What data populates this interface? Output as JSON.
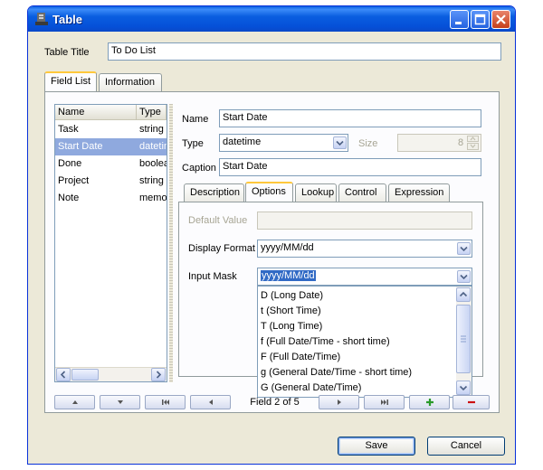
{
  "window": {
    "title": "Table",
    "colors": {
      "titlebar": "#0a5ee0",
      "close": "#c5401c",
      "selection": "#316ac5"
    }
  },
  "table_title": {
    "label": "Table Title",
    "value": "To Do List"
  },
  "main_tabs": [
    {
      "label": "Field List"
    },
    {
      "label": "Information"
    }
  ],
  "field_grid": {
    "columns": [
      "Name",
      "Type"
    ],
    "rows": [
      {
        "name": "Task",
        "type": "string"
      },
      {
        "name": "Start Date",
        "type": "datetime"
      },
      {
        "name": "Done",
        "type": "boolean"
      },
      {
        "name": "Project",
        "type": "string"
      },
      {
        "name": "Note",
        "type": "memo"
      }
    ],
    "selected_index": 1
  },
  "field": {
    "name_label": "Name",
    "name_value": "Start Date",
    "type_label": "Type",
    "type_value": "datetime",
    "size_label": "Size",
    "size_value": "8",
    "caption_label": "Caption",
    "caption_value": "Start Date"
  },
  "sub_tabs": [
    {
      "label": "Description"
    },
    {
      "label": "Options"
    },
    {
      "label": "Lookup"
    },
    {
      "label": "Control"
    },
    {
      "label": "Expression"
    }
  ],
  "options": {
    "default_value_label": "Default Value",
    "display_format_label": "Display Format",
    "display_format_value": "yyyy/MM/dd",
    "input_mask_label": "Input Mask",
    "input_mask_value": "yyyy/MM/dd",
    "input_mask_options": [
      "D (Long Date)",
      "t (Short Time)",
      "T (Long Time)",
      "f (Full Date/Time - short time)",
      "F (Full Date/Time)",
      "g (General Date/Time - short time)",
      "G (General Date/Time)"
    ]
  },
  "navigator": {
    "status": "Field 2 of 5"
  },
  "buttons": {
    "save": "Save",
    "cancel": "Cancel"
  }
}
